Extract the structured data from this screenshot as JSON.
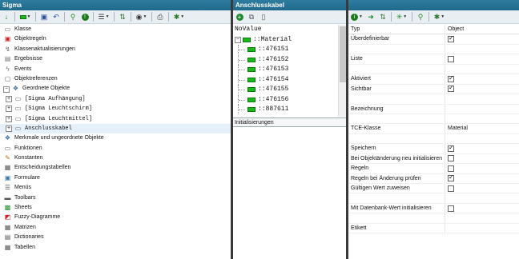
{
  "left": {
    "title": "Sigma",
    "tree": [
      {
        "label": "Klasse",
        "icon": "class-icon",
        "glyph": "▭",
        "color": "#555555",
        "expander": ""
      },
      {
        "label": "Objektregeln",
        "icon": "rules-icon",
        "glyph": "▣",
        "color": "#cc2222",
        "expander": ""
      },
      {
        "label": "Klassenaktualisierungen",
        "icon": "update-icon",
        "glyph": "↯",
        "color": "#666666",
        "expander": ""
      },
      {
        "label": "Ergebnisse",
        "icon": "results-icon",
        "glyph": "▤",
        "color": "#777777",
        "expander": ""
      },
      {
        "label": "Events",
        "icon": "lightning-icon",
        "glyph": "ϟ",
        "color": "#777777",
        "expander": ""
      },
      {
        "label": "Objektreferenzen",
        "icon": "reference-icon",
        "glyph": "▢",
        "color": "#666666",
        "expander": ""
      },
      {
        "label": "Geordnete Objekte",
        "icon": "ordered-objects-icon",
        "glyph": "❖",
        "color": "#3366aa",
        "expander": "-"
      },
      {
        "label": "[Sigma Aufhängung]",
        "icon": "object-icon",
        "glyph": "▭",
        "color": "#555555",
        "expander": "+",
        "mono": true,
        "indent": 1
      },
      {
        "label": "[Sigma Leuchtschirm]",
        "icon": "object-icon",
        "glyph": "▭",
        "color": "#555555",
        "expander": "+",
        "mono": true,
        "indent": 1
      },
      {
        "label": "[Sigma Leuchtmittel]",
        "icon": "object-icon",
        "glyph": "▭",
        "color": "#555555",
        "expander": "+",
        "mono": true,
        "indent": 1
      },
      {
        "label": "Anschlusskabel",
        "icon": "object-icon",
        "glyph": "▭",
        "color": "#555555",
        "expander": "+",
        "mono": true,
        "indent": 1,
        "selected": true
      },
      {
        "label": "Merkmale und ungeordnete Objekte",
        "icon": "features-icon",
        "glyph": "❖",
        "color": "#3366aa",
        "expander": ""
      },
      {
        "label": "Funktionen",
        "icon": "functions-icon",
        "glyph": "▭",
        "color": "#555555",
        "expander": ""
      },
      {
        "label": "Konstanten",
        "icon": "constants-icon",
        "glyph": "✎",
        "color": "#aa7722",
        "expander": ""
      },
      {
        "label": "Entscheidungstabellen",
        "icon": "decision-table-icon",
        "glyph": "▦",
        "color": "#555555",
        "expander": ""
      },
      {
        "label": "Formulare",
        "icon": "forms-icon",
        "glyph": "▣",
        "color": "#3377aa",
        "expander": ""
      },
      {
        "label": "Menüs",
        "icon": "menu-icon",
        "glyph": "☰",
        "color": "#555555",
        "expander": ""
      },
      {
        "label": "Toolbars",
        "icon": "toolbar-icon",
        "glyph": "▬",
        "color": "#555555",
        "expander": ""
      },
      {
        "label": "Sheets",
        "icon": "sheets-icon",
        "glyph": "▩",
        "color": "#1e8c2e",
        "expander": ""
      },
      {
        "label": "Fuzzy-Diagramme",
        "icon": "fuzzy-diagram-icon",
        "glyph": "◩",
        "color": "#cc2222",
        "expander": ""
      },
      {
        "label": "Matrizen",
        "icon": "matrix-icon",
        "glyph": "▦",
        "color": "#555555",
        "expander": ""
      },
      {
        "label": "Dictionaries",
        "icon": "dictionary-icon",
        "glyph": "▤",
        "color": "#555555",
        "expander": ""
      },
      {
        "label": "Tabellen",
        "icon": "table-icon",
        "glyph": "▦",
        "color": "#555555",
        "expander": ""
      }
    ]
  },
  "middle": {
    "title": "Anschlusskabel",
    "list": [
      {
        "label": "NoValue",
        "kind": "plain"
      },
      {
        "label": "::Material",
        "kind": "root"
      },
      {
        "label": "::476151",
        "kind": "child"
      },
      {
        "label": "::476152",
        "kind": "child"
      },
      {
        "label": "::476153",
        "kind": "child"
      },
      {
        "label": "::476154",
        "kind": "child"
      },
      {
        "label": "::476155",
        "kind": "child"
      },
      {
        "label": "::476156",
        "kind": "child"
      },
      {
        "label": "::887611",
        "kind": "child"
      }
    ],
    "init_label": "Initialisierungen"
  },
  "right": {
    "header": {
      "key": "Typ",
      "value": "Object"
    },
    "rows": [
      {
        "key": "Überdefinierbar",
        "type": "check",
        "checked": true
      },
      {
        "key": "",
        "type": "text",
        "value": ""
      },
      {
        "key": "Liste",
        "type": "check",
        "checked": false
      },
      {
        "key": "",
        "type": "text",
        "value": ""
      },
      {
        "key": "Aktiviert",
        "type": "check",
        "checked": true
      },
      {
        "key": "Sichtbar",
        "type": "check",
        "checked": true
      },
      {
        "key": "",
        "type": "text",
        "value": ""
      },
      {
        "key": "Bezeichnung",
        "type": "text",
        "value": ""
      },
      {
        "key": "",
        "type": "text",
        "value": ""
      },
      {
        "key": "TCE-Klasse",
        "type": "text",
        "value": "Material"
      },
      {
        "key": "",
        "type": "text",
        "value": ""
      },
      {
        "key": "Speichern",
        "type": "check",
        "checked": true
      },
      {
        "key": "Bei Objektänderung neu initialisieren",
        "type": "check",
        "checked": false
      },
      {
        "key": "Regeln",
        "type": "check",
        "checked": false
      },
      {
        "key": "Regeln bei Änderung prüfen",
        "type": "check",
        "checked": true
      },
      {
        "key": "Gültigen Wert zuweisen",
        "type": "check",
        "checked": false
      },
      {
        "key": "",
        "type": "text",
        "value": ""
      },
      {
        "key": "Mit Datenbank-Wert initialisieren",
        "type": "check",
        "checked": false
      },
      {
        "key": "",
        "type": "text",
        "value": ""
      },
      {
        "key": "Etikett",
        "type": "text",
        "value": ""
      }
    ]
  },
  "colors": {
    "titlebar": "#1f6a8c",
    "selected_row": "#e6f0fa",
    "green_item": "#18b918"
  }
}
